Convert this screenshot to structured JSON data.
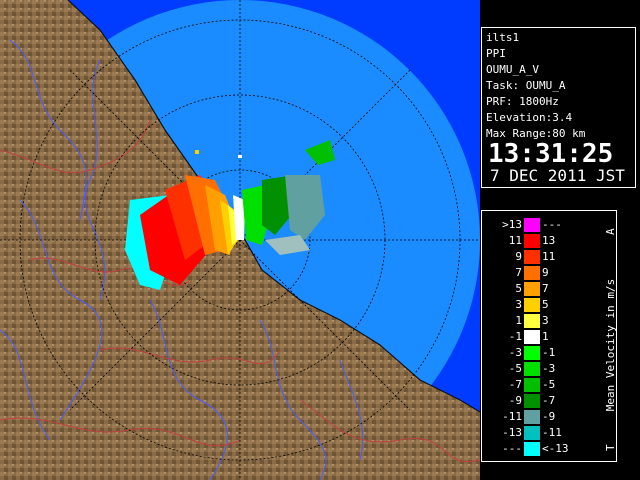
{
  "info": {
    "lines": [
      "ilts1",
      "PPI",
      "OUMU_A_V",
      "Task: OUMU_A",
      "PRF: 1800Hz",
      "Elevation:3.4",
      "Max Range:80 km"
    ],
    "time": "13:31:25",
    "date": "7 DEC 2011 JST"
  },
  "legend": {
    "title": "Mean Velocity in m/s",
    "top_marker": "A",
    "bottom_marker": "T",
    "rows": [
      {
        "low": ">13",
        "high": "---",
        "color": "#ff00ff"
      },
      {
        "low": "11",
        "high": "13",
        "color": "#ff0000"
      },
      {
        "low": "9",
        "high": "11",
        "color": "#ff3000"
      },
      {
        "low": "7",
        "high": "9",
        "color": "#ff7000"
      },
      {
        "low": "5",
        "high": "7",
        "color": "#ffa000"
      },
      {
        "low": "3",
        "high": "5",
        "color": "#ffd000"
      },
      {
        "low": "1",
        "high": "3",
        "color": "#ffff40"
      },
      {
        "low": "-1",
        "high": "1",
        "color": "#ffffff"
      },
      {
        "low": "-3",
        "high": "-1",
        "color": "#00ff00"
      },
      {
        "low": "-5",
        "high": "-3",
        "color": "#00e000"
      },
      {
        "low": "-7",
        "high": "-5",
        "color": "#00c000"
      },
      {
        "low": "-9",
        "high": "-7",
        "color": "#009000"
      },
      {
        "low": "-11",
        "high": "-9",
        "color": "#60a0a0"
      },
      {
        "low": "-13",
        "high": "-11",
        "color": "#00c0c0"
      },
      {
        "low": "---",
        "high": "<-13",
        "color": "#00ffff"
      }
    ]
  },
  "colors": {
    "sea_deep": "#003cff",
    "sea_range": "#1a8cff",
    "land": "#8a6b45",
    "river": "#4a5cff",
    "border": "#c04040"
  }
}
